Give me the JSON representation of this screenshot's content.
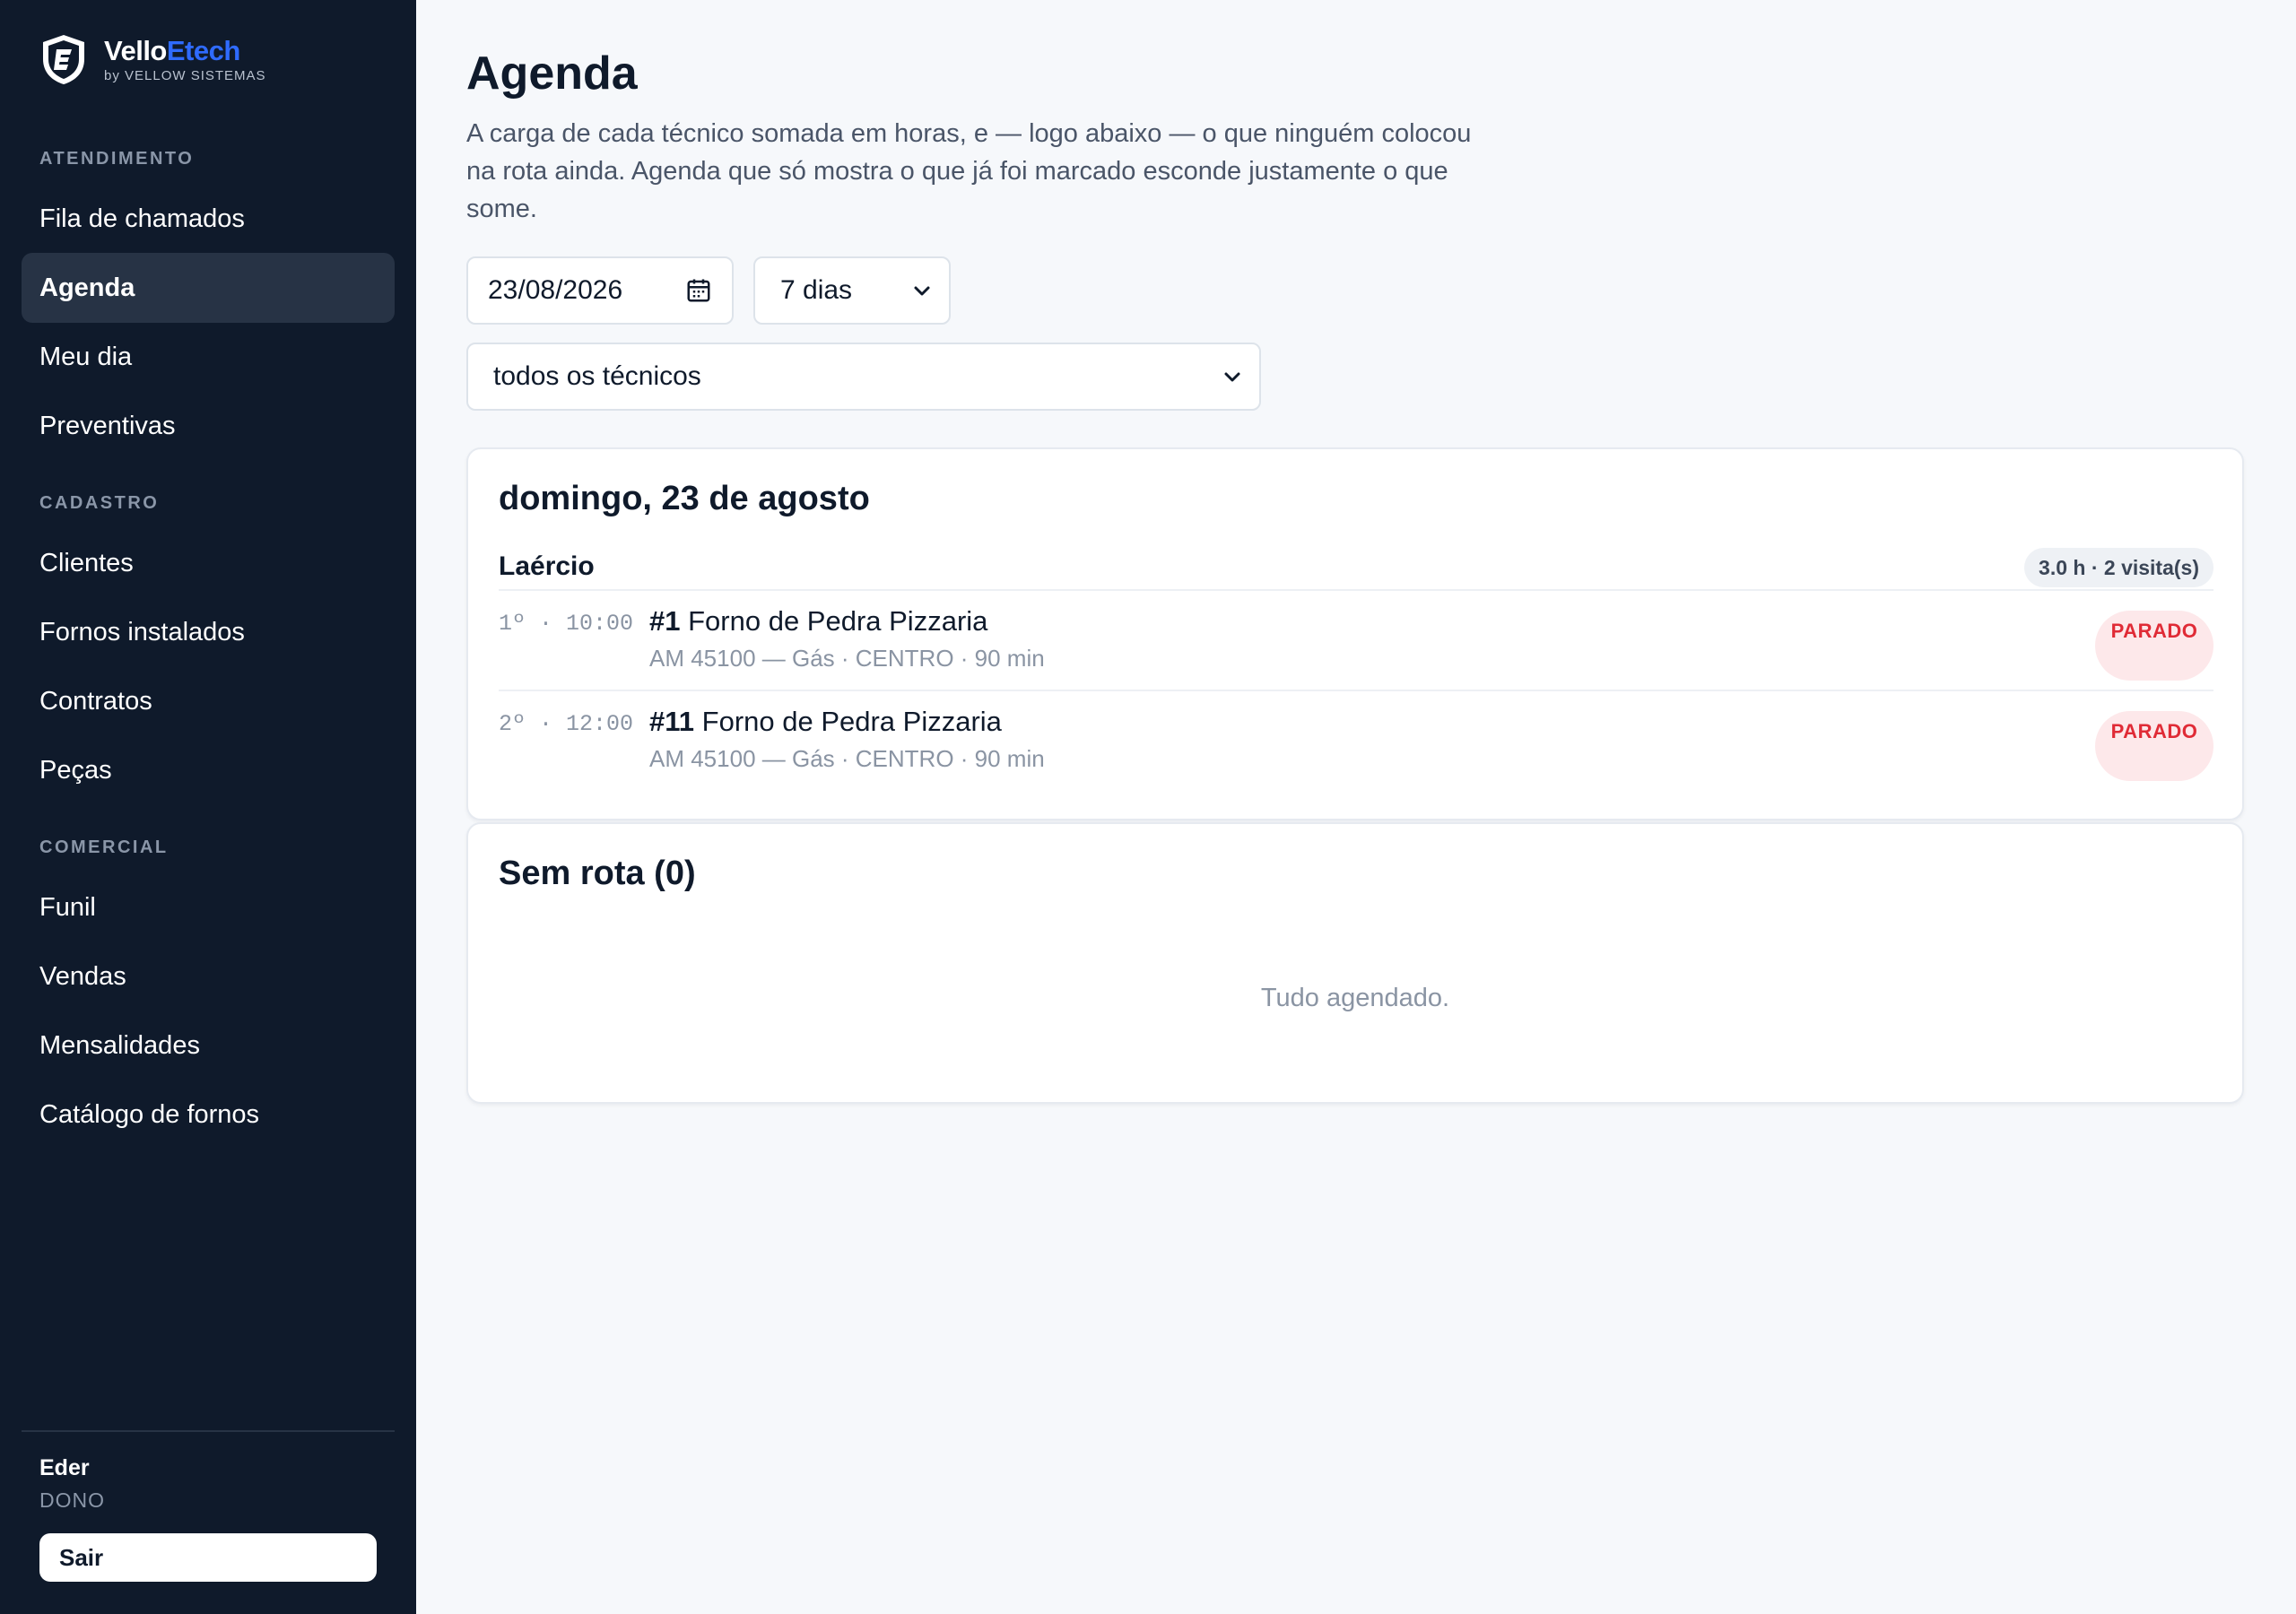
{
  "brand": {
    "name_part1": "Vello",
    "name_part2": "Etech",
    "subtitle": "by VELLOW SISTEMAS"
  },
  "sidebar": {
    "sections": [
      {
        "label": "ATENDIMENTO",
        "items": [
          "Fila de chamados",
          "Agenda",
          "Meu dia",
          "Preventivas"
        ]
      },
      {
        "label": "CADASTRO",
        "items": [
          "Clientes",
          "Fornos instalados",
          "Contratos",
          "Peças"
        ]
      },
      {
        "label": "COMERCIAL",
        "items": [
          "Funil",
          "Vendas",
          "Mensalidades",
          "Catálogo de fornos"
        ]
      }
    ],
    "active_item": "Agenda",
    "user": {
      "name": "Eder",
      "role": "DONO"
    },
    "logout_label": "Sair"
  },
  "page": {
    "title": "Agenda",
    "description": "A carga de cada técnico somada em horas, e — logo abaixo — o que ninguém colocou na rota ainda. Agenda que só mostra o que já foi marcado esconde justamente o que some."
  },
  "filters": {
    "date_value": "23/08/2026",
    "range_value": "7 dias",
    "technician_value": "todos os técnicos"
  },
  "day_card": {
    "title": "domingo, 23 de agosto",
    "technician": "Laércio",
    "load": "3.0 h · 2 visita(s)",
    "visits": [
      {
        "time": "1º · 10:00",
        "number": "#1",
        "name": "Forno de Pedra Pizzaria",
        "details": "AM 45100 — Gás · CENTRO · 90 min",
        "status": "PARADO"
      },
      {
        "time": "2º · 12:00",
        "number": "#11",
        "name": "Forno de Pedra Pizzaria",
        "details": "AM 45100 — Gás · CENTRO · 90 min",
        "status": "PARADO"
      }
    ]
  },
  "unrouted_card": {
    "title": "Sem rota (0)",
    "empty_message": "Tudo agendado."
  },
  "colors": {
    "sidebar_bg": "#0f1a2b",
    "brand_accent": "#2f6bff",
    "status_red": "#e02b36",
    "status_red_bg": "#fde8ea"
  }
}
